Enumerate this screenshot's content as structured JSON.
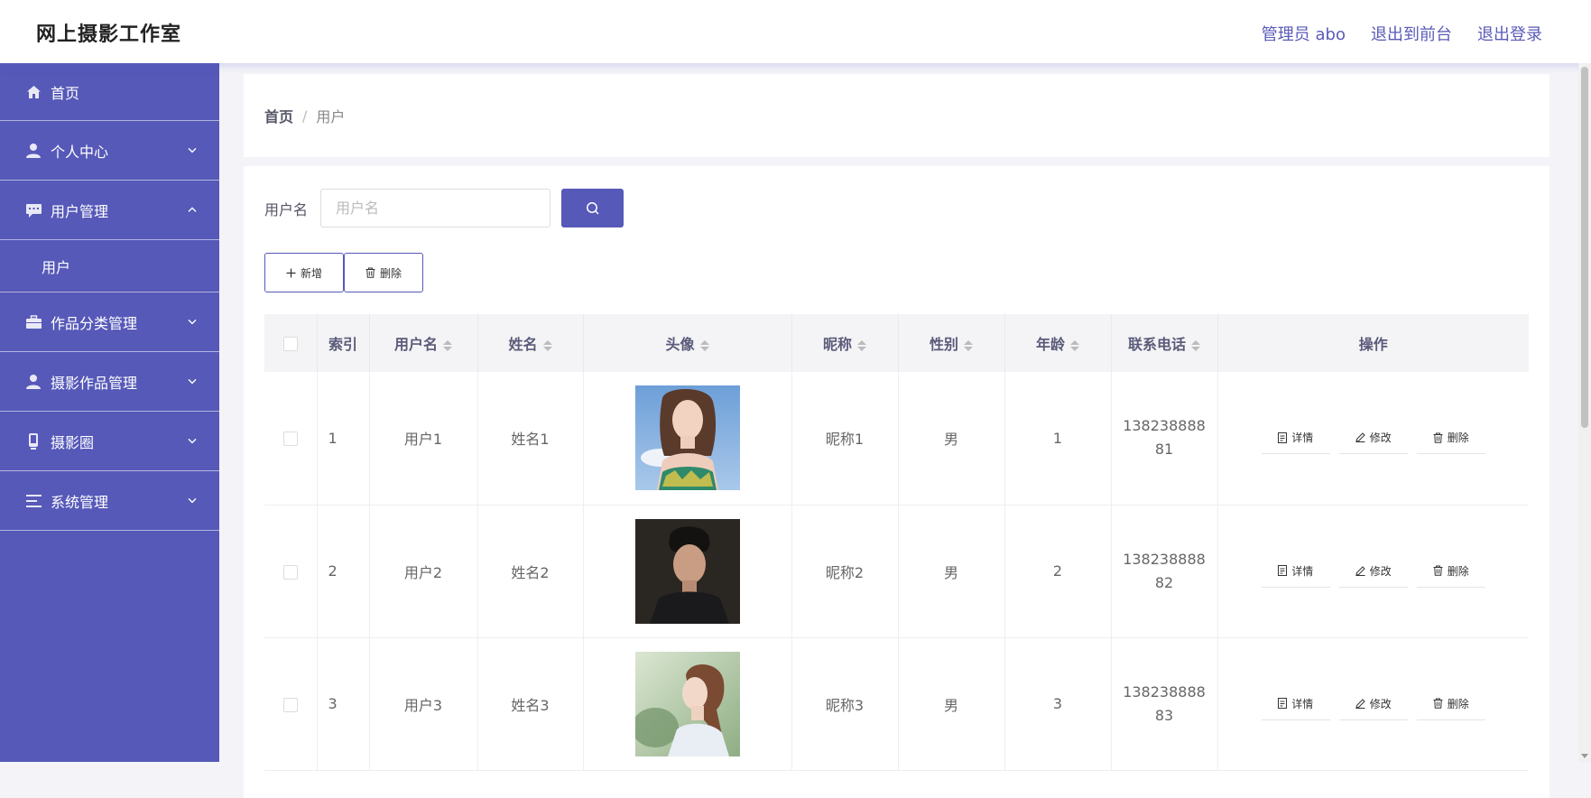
{
  "header": {
    "brand": "网上摄影工作室",
    "admin": "管理员 abo",
    "front": "退出到前台",
    "logout": "退出登录"
  },
  "sidebar": {
    "items": [
      {
        "label": "首页",
        "icon": "home-icon"
      },
      {
        "label": "个人中心",
        "icon": "user-icon"
      },
      {
        "label": "用户管理",
        "icon": "chat-icon",
        "expanded": true,
        "children": [
          "用户"
        ]
      },
      {
        "label": "作品分类管理",
        "icon": "briefcase-icon"
      },
      {
        "label": "摄影作品管理",
        "icon": "user-icon"
      },
      {
        "label": "摄影圈",
        "icon": "phone-icon"
      },
      {
        "label": "系统管理",
        "icon": "list-icon"
      }
    ]
  },
  "breadcrumb": {
    "home": "首页",
    "sep": "/",
    "current": "用户"
  },
  "search": {
    "label": "用户名",
    "placeholder": "用户名",
    "value": ""
  },
  "actions": {
    "add": "新增",
    "delete": "删除"
  },
  "table": {
    "headers": [
      "索引",
      "用户名",
      "姓名",
      "头像",
      "昵称",
      "性别",
      "年龄",
      "联系电话",
      "操作"
    ],
    "rows": [
      {
        "index": "1",
        "username": "用户1",
        "name": "姓名1",
        "nickname": "昵称1",
        "gender": "男",
        "age": "1",
        "phone": "13823888881"
      },
      {
        "index": "2",
        "username": "用户2",
        "name": "姓名2",
        "nickname": "昵称2",
        "gender": "男",
        "age": "2",
        "phone": "13823888882"
      },
      {
        "index": "3",
        "username": "用户3",
        "name": "姓名3",
        "nickname": "昵称3",
        "gender": "男",
        "age": "3",
        "phone": "13823888883"
      }
    ],
    "ops": {
      "detail": "详情",
      "edit": "修改",
      "delete": "删除"
    }
  },
  "colors": {
    "accent": "#5659b8",
    "sidebar_bg": "#5659b8"
  }
}
